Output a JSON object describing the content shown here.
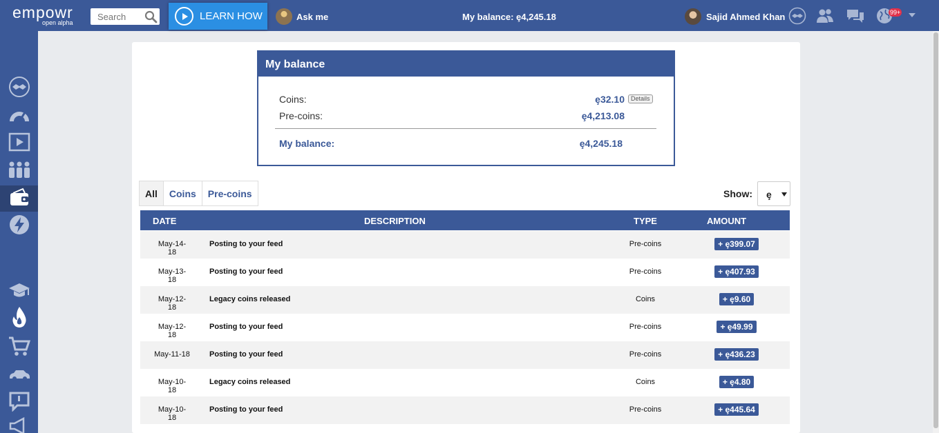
{
  "header": {
    "logo_name": "empowr",
    "logo_sub": "open alpha",
    "search_placeholder": "Search",
    "learn_label": "LEARN HOW",
    "ask_label": "Ask me",
    "balance_text": "My balance: ȩ4,245.18",
    "user_name": "Sajid Ahmed Khan",
    "notifications_badge": "99+"
  },
  "colors": {
    "brand": "#3b5998",
    "sidebar_active": "#2d4373",
    "learn_button": "#2b8fe3",
    "badge": "#e0314a"
  },
  "sidebar": {
    "icons": [
      "handshake-icon",
      "gauge-icon",
      "play-icon",
      "people-icon",
      "wallet-icon",
      "lightning-icon",
      "graduation-cap-icon",
      "flame-icon",
      "cart-icon",
      "car-icon",
      "chat-icon",
      "megaphone-icon"
    ],
    "active": "wallet-icon"
  },
  "balance_box": {
    "title": "My balance",
    "coins_label": "Coins:",
    "coins_value": "ȩ32.10",
    "details_label": "Details",
    "precoins_label": "Pre-coins:",
    "precoins_value": "ȩ4,213.08",
    "total_label": "My balance:",
    "total_value": "ȩ4,245.18"
  },
  "tabs": [
    {
      "label": "All",
      "active": true
    },
    {
      "label": "Coins",
      "active": false
    },
    {
      "label": "Pre-coins",
      "active": false
    }
  ],
  "show": {
    "label": "Show:",
    "value": "ȩ"
  },
  "table": {
    "headers": {
      "date": "DATE",
      "description": "DESCRIPTION",
      "type": "TYPE",
      "amount": "AMOUNT"
    },
    "rows": [
      {
        "date": "May-14-18",
        "description": "Posting to your feed",
        "type": "Pre-coins",
        "amount": "+ ȩ399.07"
      },
      {
        "date": "May-13-18",
        "description": "Posting to your feed",
        "type": "Pre-coins",
        "amount": "+ ȩ407.93"
      },
      {
        "date": "May-12-18",
        "description": "Legacy coins released",
        "type": "Coins",
        "amount": "+ ȩ9.60"
      },
      {
        "date": "May-12-18",
        "description": "Posting to your feed",
        "type": "Pre-coins",
        "amount": "+ ȩ49.99"
      },
      {
        "date": "May-11-18",
        "description": "Posting to your feed",
        "type": "Pre-coins",
        "amount": "+ ȩ436.23"
      },
      {
        "date": "May-10-18",
        "description": "Legacy coins released",
        "type": "Coins",
        "amount": "+ ȩ4.80"
      },
      {
        "date": "May-10-18",
        "description": "Posting to your feed",
        "type": "Pre-coins",
        "amount": "+ ȩ445.64"
      }
    ]
  }
}
